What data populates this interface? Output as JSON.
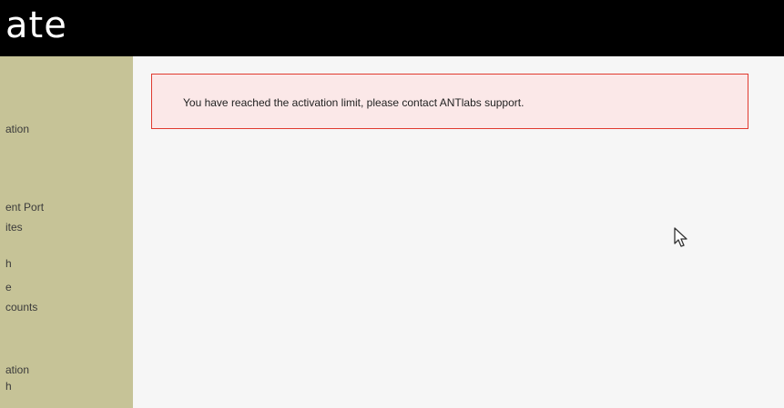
{
  "header": {
    "title": "ate"
  },
  "sidebar": {
    "items": [
      {
        "label": "ation"
      },
      {
        "label": "ent Port"
      },
      {
        "label": "ites"
      },
      {
        "label": "h"
      },
      {
        "label": "e"
      },
      {
        "label": "counts"
      },
      {
        "label": "ation"
      },
      {
        "label": "h"
      }
    ]
  },
  "alert": {
    "message": "You have reached the activation limit, please contact ANTlabs support.",
    "border_color": "#e03a2f",
    "background_color": "#fbe8e8"
  },
  "colors": {
    "topbar": "#000000",
    "sidebar": "#c6c397",
    "content_bg": "#f6f6f6"
  },
  "cursor": {
    "icon": "mouse-pointer-icon"
  }
}
